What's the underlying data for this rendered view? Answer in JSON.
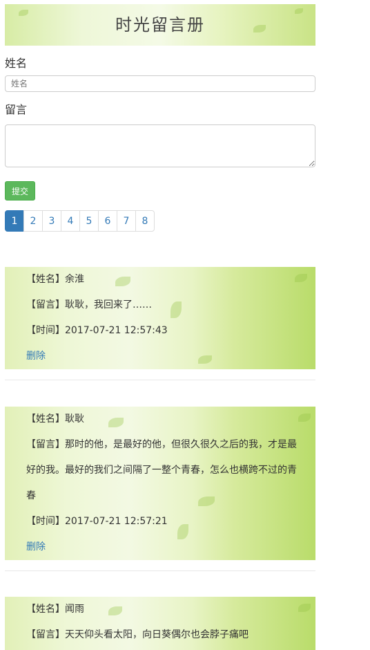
{
  "app": {
    "title": "时光留言册"
  },
  "form": {
    "name_label": "姓名",
    "name_placeholder": "姓名",
    "message_label": "留言",
    "submit_label": "提交"
  },
  "pagination": {
    "pages": [
      "1",
      "2",
      "3",
      "4",
      "5",
      "6",
      "7",
      "8"
    ],
    "active": "1"
  },
  "entries": [
    {
      "name_prefix": "【姓名】",
      "name": "余淮",
      "msg_prefix": "【留言】",
      "message": "耿耿，我回来了……",
      "time_prefix": "【时间】",
      "time": "2017-07-21 12:57:43",
      "delete_label": "删除"
    },
    {
      "name_prefix": "【姓名】",
      "name": "耿耿",
      "msg_prefix": "【留言】",
      "message_lines": [
        "那时的他，是最好的他，但很久很久之后的我，才是最",
        "好的我。最好的我们之间隔了一整个青春，怎么也横跨不过的青",
        "春"
      ],
      "time_prefix": "【时间】",
      "time": "2017-07-21 12:57:21",
      "delete_label": "删除"
    },
    {
      "name_prefix": "【姓名】",
      "name": "闻雨",
      "msg_prefix": "【留言】",
      "message": "天天仰头看太阳，向日葵偶尔也会脖子痛吧"
    }
  ]
}
